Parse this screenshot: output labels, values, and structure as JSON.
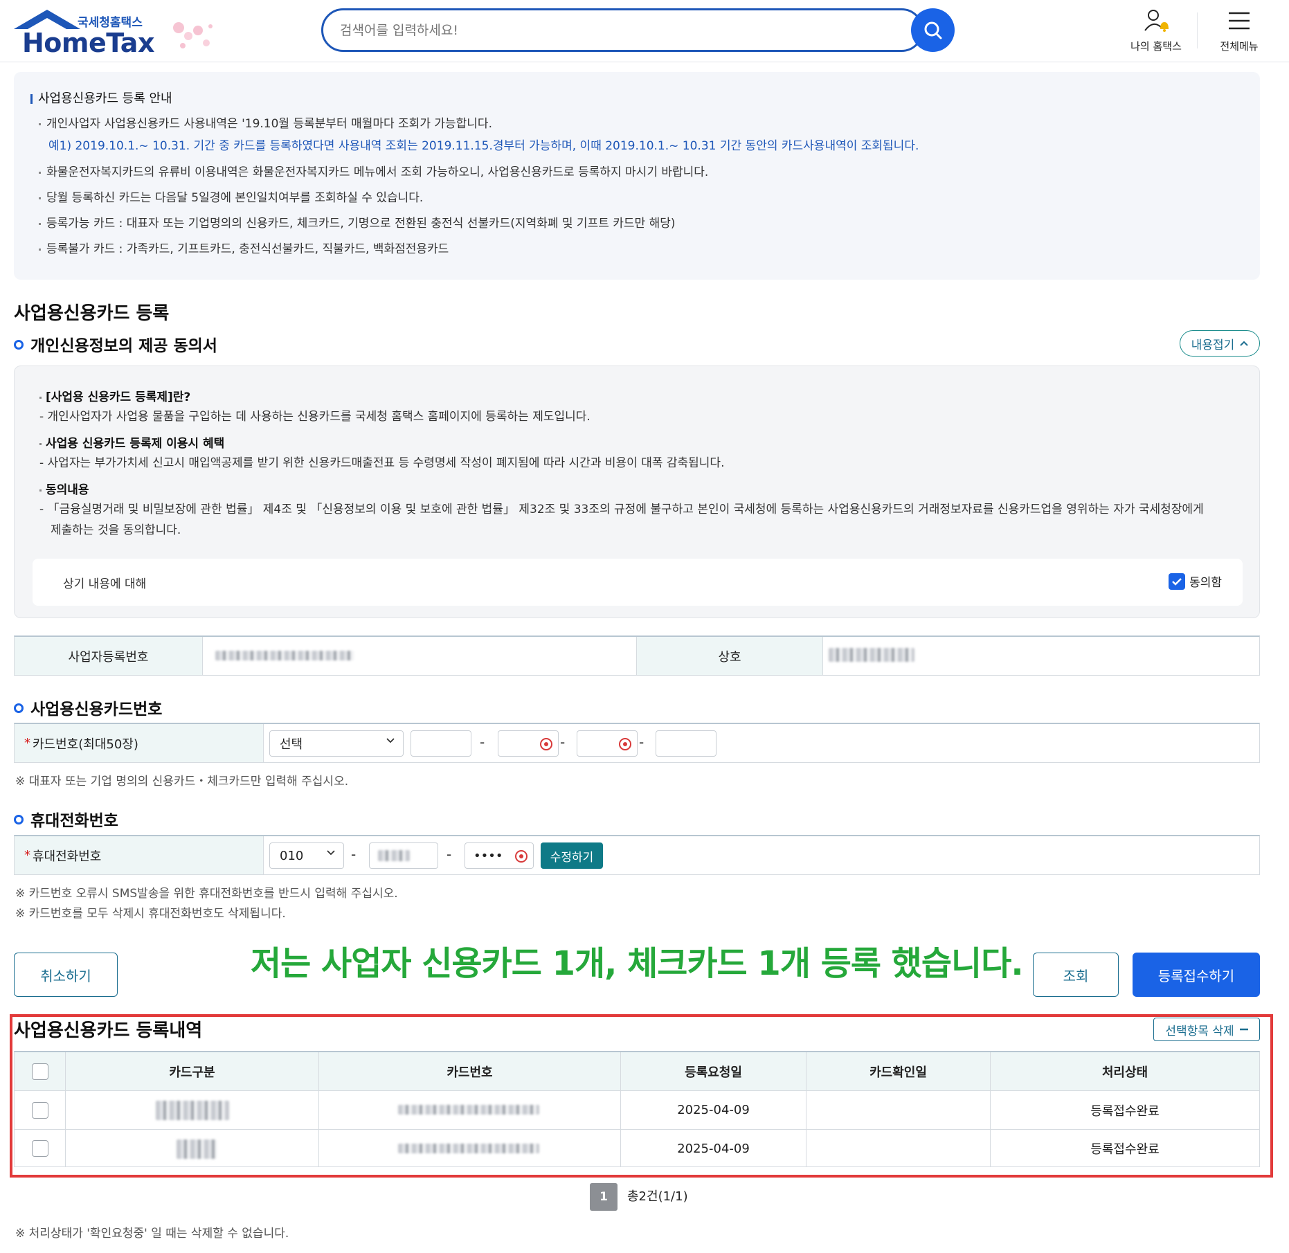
{
  "header": {
    "logo_sub": "국세청홈택스",
    "logo_main": "HomeTax",
    "search_placeholder": "검색어를 입력하세요!",
    "my_hometax": "나의 홈택스",
    "all_menu": "전체메뉴"
  },
  "notice": {
    "title": "사업용신용카드 등록 안내",
    "lines": [
      "개인사업자 사업용신용카드 사용내역은 '19.10월 등록분부터 매월마다 조회가 가능합니다.",
      "예1) 2019.10.1.~ 10.31. 기간 중 카드를 등록하였다면 사용내역 조회는 2019.11.15.경부터 가능하며, 이때 2019.10.1.~ 10.31 기간 동안의 카드사용내역이 조회됩니다.",
      "화물운전자복지카드의 유류비 이용내역은 화물운전자복지카드 메뉴에서 조회 가능하오니, 사업용신용카드로 등록하지 마시기 바랍니다.",
      "당월 등록하신 카드는 다음달 5일경에 본인일치여부를 조회하실 수 있습니다.",
      "등록가능 카드 : 대표자 또는 기업명의의 신용카드, 체크카드, 기명으로 전환된 충전식 선불카드(지역화폐 및 기프트 카드만 해당)",
      "등록불가 카드 : 가족카드, 기프트카드, 충전식선불카드, 직불카드, 백화점전용카드"
    ]
  },
  "page_title": "사업용신용카드 등록",
  "consent": {
    "title": "개인신용정보의 제공 동의서",
    "collapse_label": "내용접기",
    "items": [
      {
        "head": "[사업용 신용카드 등록제]란?",
        "body": "- 개인사업자가 사업용 물품을 구입하는 데 사용하는 신용카드를 국세청 홈택스 홈페이지에 등록하는 제도입니다."
      },
      {
        "head": "사업용 신용카드 등록제 이용시 혜택",
        "body": "- 사업자는 부가가치세 신고시 매입액공제를 받기 위한 신용카드매출전표 등 수령명세 작성이 폐지됨에 따라 시간과 비용이 대폭 감축됩니다."
      },
      {
        "head": "동의내용",
        "body": "- 「금융실명거래 및 비밀보장에 관한 법률」 제4조 및 「신용정보의 이용 및 보호에 관한 법률」 제32조 및 33조의 규정에 불구하고 본인이 국세청에 등록하는 사업용신용카드의    거래정보자료를 신용카드업을 영위하는 자가 국세청장에게",
        "body2": "제출하는 것을 동의합니다."
      }
    ],
    "agree_row_label": "상기 내용에 대해",
    "agree_label": "동의함"
  },
  "biz_info": {
    "reg_no_label": "사업자등록번호",
    "name_label": "상호"
  },
  "card_section": {
    "title": "사업용신용카드번호",
    "label": "카드번호(최대50장)",
    "select_value": "선택",
    "dash": "-",
    "note": "※ 대표자 또는 기업 명의의 신용카드・체크카드만 입력해 주십시오."
  },
  "phone_section": {
    "title": "휴대전화번호",
    "label": "휴대전화번호",
    "prefix": "010",
    "masked": "••••",
    "edit_button": "수정하기",
    "note1": "※ 카드번호 오류시 SMS발송을 위한 휴대전화번호를 반드시 입력해 주십시오.",
    "note2": "※ 카드번호를 모두 삭제시 휴대전화번호도 삭제됩니다."
  },
  "actions": {
    "cancel": "취소하기",
    "search": "조회",
    "submit": "등록접수하기"
  },
  "overlay_text": "저는 사업자 신용카드 1개, 체크카드 1개 등록 했습니다.",
  "list": {
    "title": "사업용신용카드 등록내역",
    "delete_selected": "선택항목 삭제",
    "columns": [
      "카드구분",
      "카드번호",
      "등록요청일",
      "카드확인일",
      "처리상태"
    ],
    "rows": [
      {
        "date": "2025-04-09",
        "confirm": "",
        "status": "등록접수완료"
      },
      {
        "date": "2025-04-09",
        "confirm": "",
        "status": "등록접수완료"
      }
    ]
  },
  "pagination": {
    "current": "1",
    "total": "총2건(1/1)"
  },
  "footer_note": "※ 처리상태가 '확인요청중' 일 때는 삭제할 수 없습니다.",
  "colors": {
    "primary": "#1a63e6",
    "teal": "#0f7a87",
    "overlay_green": "#25a83a",
    "highlight_red": "#e23a3a"
  }
}
